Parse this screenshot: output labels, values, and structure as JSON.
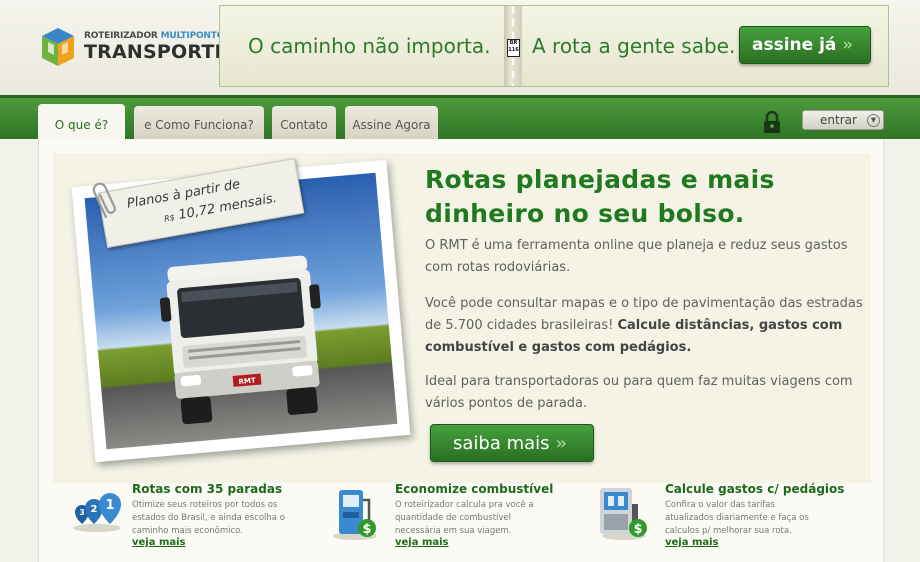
{
  "brand": {
    "subtitle_part1": "ROTEIRIZADOR ",
    "subtitle_part2": "MULTIPONTO",
    "name": "TRANSPORTES"
  },
  "banner": {
    "left_text": "O caminho não importa.",
    "sign_line1": "BR",
    "sign_line2": "116",
    "right_text": "A rota a gente sabe.",
    "cta_label": "assine já",
    "cta_chevrons": "››"
  },
  "nav": {
    "tabs": [
      {
        "label": "O que é?",
        "active": true
      },
      {
        "label": "e Como Funciona?",
        "active": false
      },
      {
        "label": "Contato",
        "active": false
      },
      {
        "label": "Assine Agora",
        "active": false
      }
    ],
    "login_label": "entrar",
    "login_arrow": "▼"
  },
  "hero": {
    "note_line1": "Planos à partir de",
    "note_currency": "R$",
    "note_line2": "10,72 mensais.",
    "plate": "RMT",
    "title": "Rotas planejadas e mais dinheiro no seu bolso.",
    "p1": "O RMT é uma ferramenta online que planeja e reduz seus gastos com rotas rodoviárias.",
    "p2_text": "Você pode consultar mapas e o tipo de pavimentação das estradas de 5.700 cidades brasileiras! ",
    "p2_bold": "Calcule distâncias, gastos com combustível e gastos com pedágios.",
    "p3": "Ideal para transportadoras ou para quem faz muitas viagens com vários pontos de parada.",
    "cta_label": "saiba mais",
    "cta_chevrons": "››"
  },
  "features": [
    {
      "icon": "route-pins-icon",
      "pin_numbers": [
        "3",
        "2",
        "1"
      ],
      "title": "Rotas com 35 paradas",
      "desc": "Otimize seus roteiros por todos os estados do Brasil, e ainda escolha o caminho mais econômico.",
      "link": "veja mais"
    },
    {
      "icon": "fuel-pump-icon",
      "symbol": "$",
      "title": "Economize combustível",
      "desc": "O roteirizador calcula pra você a quantidade de combustível necessária em sua viagem.",
      "link": "veja mais"
    },
    {
      "icon": "toll-booth-icon",
      "symbol": "$",
      "title": "Calcule gastos c/ pedágios",
      "desc": "Confira o valor das tarifas atualizados diariamente e faça os calculos p/ melhorar sua rota.",
      "link": "veja mais"
    }
  ],
  "colors": {
    "brand_green": "#2f7526",
    "title_green": "#1f7a1f",
    "accent_blue": "#3b8cc8"
  }
}
